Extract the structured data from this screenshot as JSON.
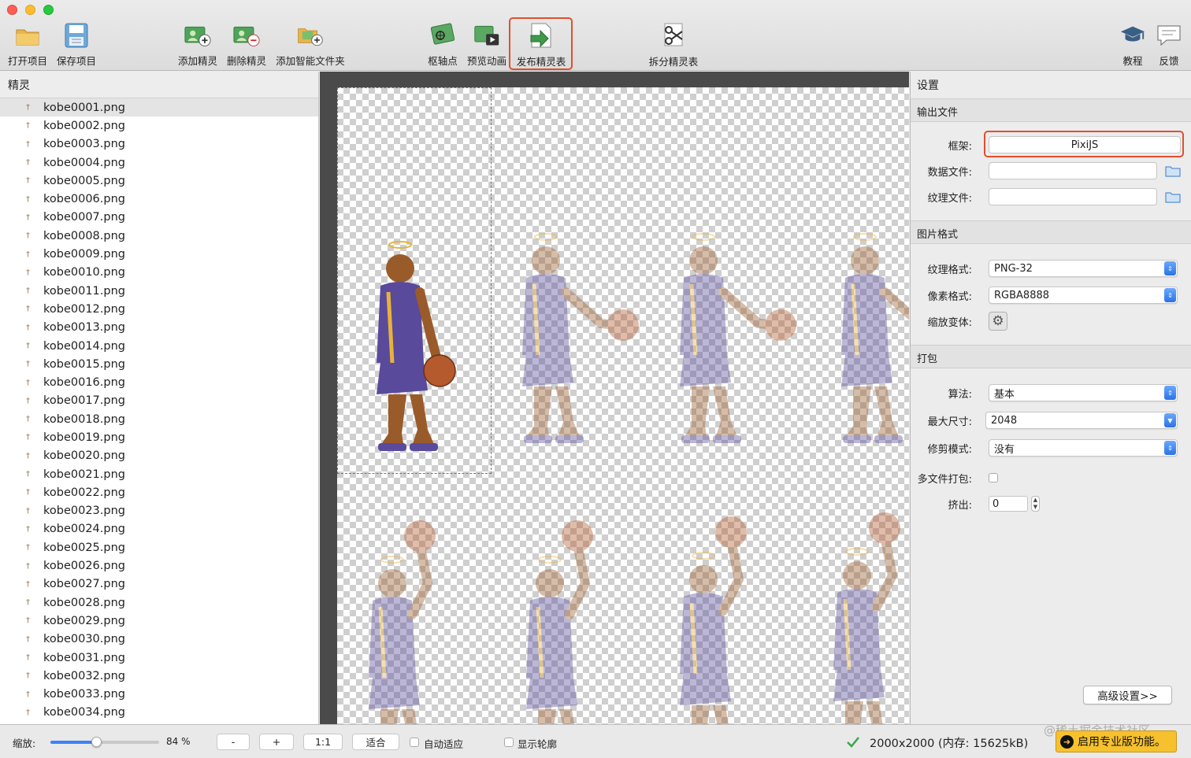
{
  "toolbar": {
    "open_project": "打开项目",
    "save_project": "保存项目",
    "add_sprite": "添加精灵",
    "delete_sprite": "删除精灵",
    "add_smart_folder": "添加智能文件夹",
    "pivot_point": "枢轴点",
    "preview_animation": "预览动画",
    "publish_sprite_sheet": "发布精灵表",
    "split_sprite_sheet": "拆分精灵表",
    "tutorial": "教程",
    "feedback": "反馈"
  },
  "sprites_panel": {
    "title": "精灵",
    "items": [
      "kobe0001.png",
      "kobe0002.png",
      "kobe0003.png",
      "kobe0004.png",
      "kobe0005.png",
      "kobe0006.png",
      "kobe0007.png",
      "kobe0008.png",
      "kobe0009.png",
      "kobe0010.png",
      "kobe0011.png",
      "kobe0012.png",
      "kobe0013.png",
      "kobe0014.png",
      "kobe0015.png",
      "kobe0016.png",
      "kobe0017.png",
      "kobe0018.png",
      "kobe0019.png",
      "kobe0020.png",
      "kobe0021.png",
      "kobe0022.png",
      "kobe0023.png",
      "kobe0024.png",
      "kobe0025.png",
      "kobe0026.png",
      "kobe0027.png",
      "kobe0028.png",
      "kobe0029.png",
      "kobe0030.png",
      "kobe0031.png",
      "kobe0032.png",
      "kobe0033.png",
      "kobe0034.png"
    ],
    "selected_index": 0
  },
  "settings": {
    "title": "设置",
    "output_section": "输出文件",
    "framework_label": "框架:",
    "framework_value": "PixiJS",
    "data_file_label": "数据文件:",
    "data_file_value": "",
    "texture_file_label": "纹理文件:",
    "texture_file_value": "",
    "image_section": "图片格式",
    "texture_format_label": "纹理格式:",
    "texture_format_value": "PNG-32",
    "pixel_format_label": "像素格式:",
    "pixel_format_value": "RGBA8888",
    "scale_variants_label": "缩放变体:",
    "packing_section": "打包",
    "algorithm_label": "算法:",
    "algorithm_value": "基本",
    "max_size_label": "最大尺寸:",
    "max_size_value": "2048",
    "trim_mode_label": "修剪模式:",
    "trim_mode_value": "没有",
    "multipack_label": "多文件打包:",
    "extrude_label": "挤出:",
    "extrude_value": "0",
    "advanced_button": "高级设置>>"
  },
  "bottombar": {
    "zoom_label": "缩放:",
    "zoom_percent": "84 %",
    "zoom_level": 0.84,
    "minus": "-",
    "plus": "+",
    "one_to_one": "1:1",
    "fit": "适合",
    "auto_fit": "自动适应",
    "show_outline": "显示轮廓",
    "status": "2000x2000 (内存: 15625kB)",
    "pro_button": "启用专业版功能。",
    "watermark": "@稀土掘金技术社区"
  },
  "colors": {
    "highlight": "#e0502e",
    "jersey": "#5a4a9c",
    "jersey_trim": "#e8b23a",
    "skin": "#9a5b2a",
    "pro_button_bg": "#f6c12c"
  }
}
